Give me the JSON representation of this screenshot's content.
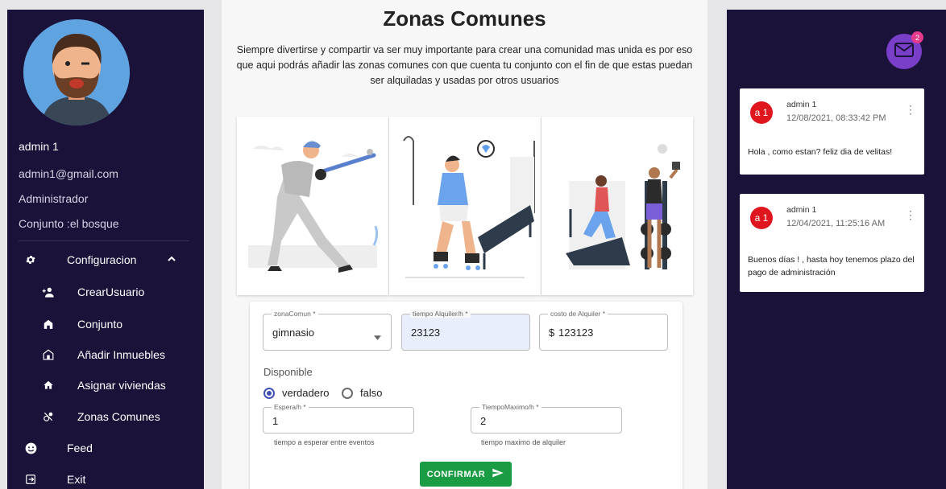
{
  "sidebar": {
    "user_name": "admin 1",
    "email": "admin1@gmail.com",
    "role": "Administrador",
    "conjunto": "Conjunto :el bosque",
    "items": [
      {
        "label": "Configuracion",
        "icon": "gear-icon"
      },
      {
        "label": "CrearUsuario",
        "icon": "add-user-icon"
      },
      {
        "label": "Conjunto",
        "icon": "building-icon"
      },
      {
        "label": "Añadir Inmuebles",
        "icon": "add-home-icon"
      },
      {
        "label": "Asignar viviendas",
        "icon": "home-icon"
      },
      {
        "label": "Zonas Comunes",
        "icon": "bubble-chart-icon"
      },
      {
        "label": "Feed",
        "icon": "smiley-icon"
      },
      {
        "label": "Exit",
        "icon": "logout-icon"
      }
    ]
  },
  "main": {
    "title": "Zonas Comunes",
    "intro": "Siempre divertirse y compartir va ser muy importante para crear una comunidad mas unida es por eso que aqui podrás añadir las zonas comunes con que cuenta tu conjunto con el fin de que estas puedan ser alquiladas y usadas por otros usuarios"
  },
  "form": {
    "zona_label": "zonaComun *",
    "zona_value": "gimnasio",
    "tiempo_label": "tiempo Alquiler/h *",
    "tiempo_value": "23123",
    "costo_label": "costo de Alquiler *",
    "costo_prefix": "$",
    "costo_value": "123123",
    "disponible_label": "Disponible",
    "radio_true": "verdadero",
    "radio_false": "falso",
    "espera_label": "Espera/h *",
    "espera_value": "1",
    "espera_helper": "tiempo a esperar entre eventos",
    "max_label": "TiempoMaximo/h *",
    "max_value": "2",
    "max_helper": "tiempo maximo de alquiler",
    "confirm_label": "CONFIRMAR"
  },
  "notifications": {
    "badge_count": "2",
    "messages": [
      {
        "avatar": "a 1",
        "author": "admin 1",
        "date": "12/08/2021, 08:33:42 PM",
        "text": "Hola , como estan? feliz dia de velitas!"
      },
      {
        "avatar": "a 1",
        "author": "admin 1",
        "date": "12/04/2021, 11:25:16 AM",
        "text": "Buenos días ! , hasta hoy tenemos plazo del pago de administración"
      }
    ]
  },
  "colors": {
    "sidebar_bg": "#1a1238",
    "accent_purple": "#7a3fc8",
    "confirm_green": "#1a9c44",
    "avatar_red": "#e0161f",
    "radio_blue": "#3f51b5"
  }
}
